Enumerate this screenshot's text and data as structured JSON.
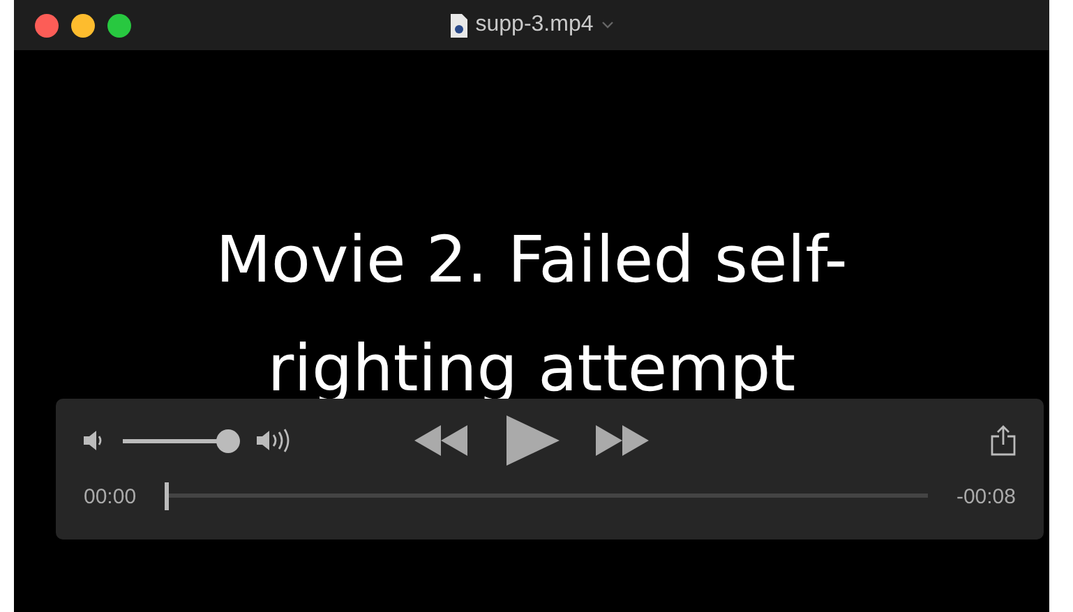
{
  "window": {
    "title": "supp-3.mp4"
  },
  "video": {
    "caption": "Movie 2. Failed self-righting attempt"
  },
  "controls": {
    "volume": {
      "level": 1.0
    },
    "progress": {
      "level": 0.0
    },
    "elapsed": "00:00",
    "remaining": "-00:08"
  }
}
